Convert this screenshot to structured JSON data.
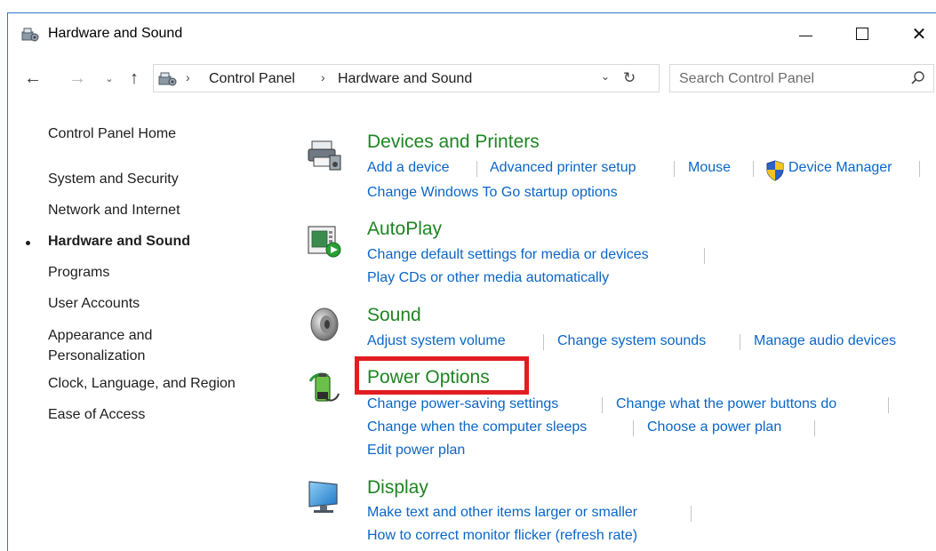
{
  "window": {
    "title": "Hardware and Sound",
    "minimize_glyph": "",
    "close_glyph": "✕"
  },
  "nav": {
    "back_glyph": "←",
    "forward_glyph": "→",
    "recent_glyph": "⌄",
    "up_glyph": "↑",
    "breadcrumb": [
      "Control Panel",
      "Hardware and Sound"
    ],
    "separator": "›",
    "dropdown_glyph": "⌄",
    "refresh_glyph": "↻",
    "search_placeholder": "Search Control Panel"
  },
  "sidebar": {
    "home": "Control Panel Home",
    "items": [
      "System and Security",
      "Network and Internet",
      "Hardware and Sound",
      "Programs",
      "User Accounts",
      "Appearance and Personalization",
      "Clock, Language, and Region",
      "Ease of Access"
    ],
    "active_index": 2
  },
  "categories": {
    "devices": {
      "title": "Devices and Printers",
      "icon": "printer-icon",
      "links": [
        "Add a device",
        "Advanced printer setup",
        "Mouse",
        "Device Manager",
        "Change Windows To Go startup options"
      ]
    },
    "autoplay": {
      "title": "AutoPlay",
      "icon": "autoplay-icon",
      "links": [
        "Change default settings for media or devices",
        "Play CDs or other media automatically"
      ]
    },
    "sound": {
      "title": "Sound",
      "icon": "speaker-icon",
      "links": [
        "Adjust system volume",
        "Change system sounds",
        "Manage audio devices"
      ]
    },
    "power": {
      "title": "Power Options",
      "icon": "battery-icon",
      "links": [
        "Change power-saving settings",
        "Change what the power buttons do",
        "Change when the computer sleeps",
        "Choose a power plan",
        "Edit power plan"
      ]
    },
    "display": {
      "title": "Display",
      "icon": "monitor-icon",
      "links": [
        "Make text and other items larger or smaller",
        "How to correct monitor flicker (refresh rate)"
      ]
    }
  },
  "colors": {
    "category_title": "#1e8522",
    "link": "#0b66c7",
    "highlight_box": "#e21c21",
    "window_border": "#2b79d0"
  }
}
